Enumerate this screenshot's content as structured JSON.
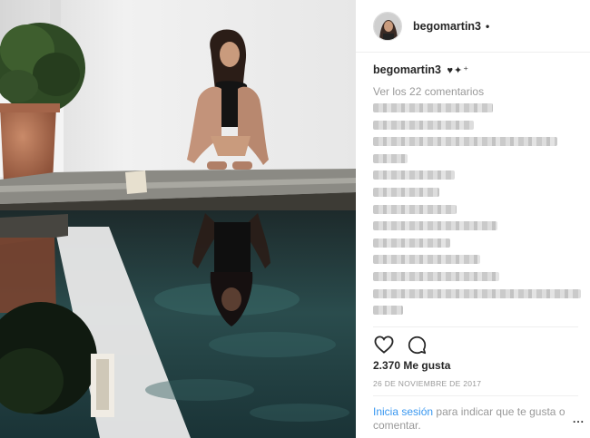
{
  "post": {
    "username": "begomartin3",
    "follow_dot": "•",
    "caption_username": "begomartin3",
    "caption_emoji": "♥✦⁺",
    "view_comments": "Ver los 22 comentarios",
    "likes": "2.370 Me gusta",
    "date": "26 DE NOVIEMBRE DE 2017",
    "login_link": "Inicia sesión",
    "login_text": "para indicar que te gusta o comentar.",
    "more_label": "..."
  },
  "icons": {
    "like": "heart-icon",
    "comment": "comment-icon",
    "more": "more-options-icon"
  },
  "comments_blurred": [
    {
      "width": 0.56
    },
    {
      "width": 0.47
    },
    {
      "width": 0.86
    },
    {
      "width": 0.16
    },
    {
      "width": 0.38
    },
    {
      "width": 0.31
    },
    {
      "width": 0.39
    },
    {
      "width": 0.58
    },
    {
      "width": 0.36
    },
    {
      "width": 0.5
    },
    {
      "width": 0.59
    },
    {
      "width": 0.97
    },
    {
      "width": 0.14
    }
  ],
  "colors": {
    "link": "#3897f0",
    "muted": "#999999",
    "text": "#262626",
    "water": "#1f3b3c"
  }
}
